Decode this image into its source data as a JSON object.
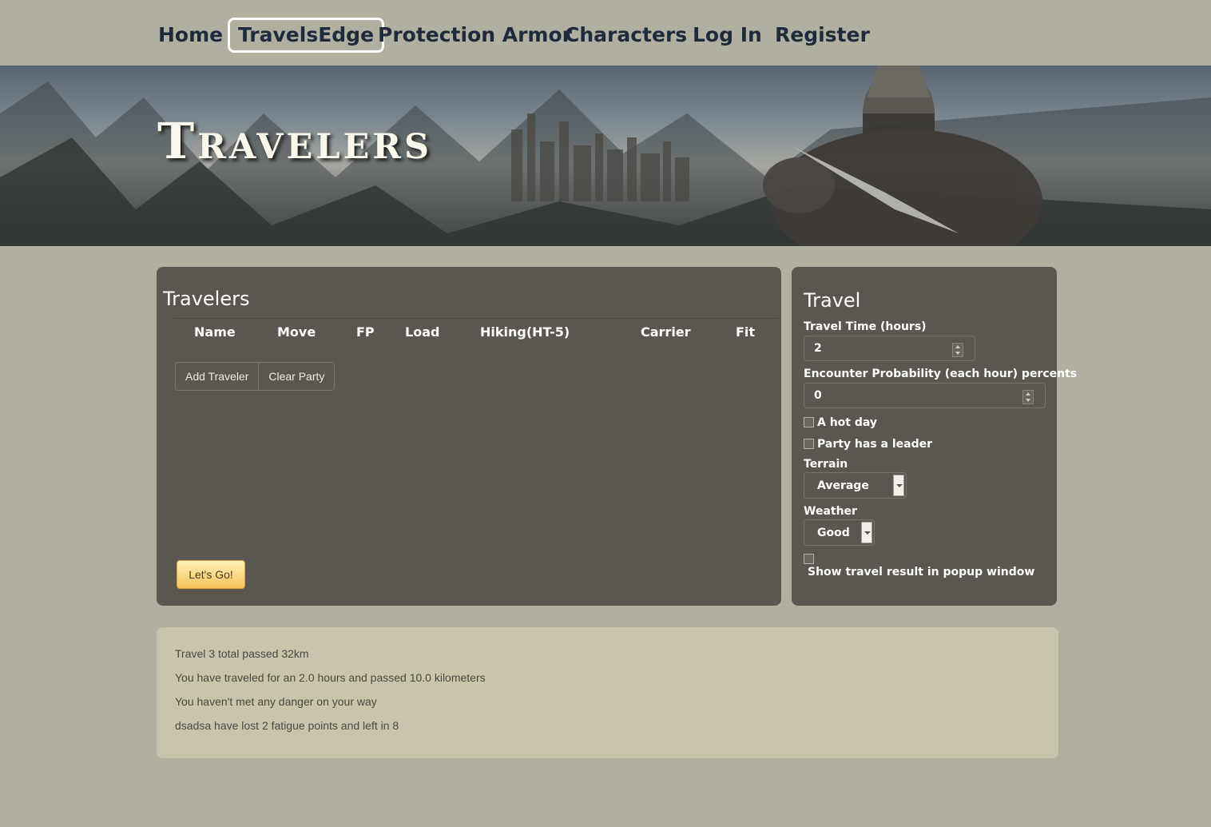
{
  "nav": {
    "items": [
      "Home",
      "TravelsEdge",
      "Protection Armor",
      "Characters",
      "Log In",
      "Register"
    ],
    "active": "TravelsEdge"
  },
  "banner": {
    "title": "Travelers"
  },
  "travelers": {
    "title": "Travelers",
    "columns": [
      "Name",
      "Move",
      "FP",
      "Load",
      "Hiking(HT-5)",
      "Carrier",
      "Fit"
    ],
    "add_button": "Add Traveler",
    "clear_button": "Clear Party",
    "go_button": "Let's Go!"
  },
  "travel": {
    "title": "Travel",
    "time_label": "Travel Time (hours)",
    "time_value": "2",
    "encounter_label": "Encounter Probability (each hour) percents",
    "encounter_value": "0",
    "hot_day_label": "A hot day",
    "hot_day_checked": false,
    "leader_label": "Party has a leader",
    "leader_checked": false,
    "terrain_label": "Terrain",
    "terrain_value": "Average",
    "weather_label": "Weather",
    "weather_value": "Good",
    "popup_label": "Show travel result in popup window",
    "popup_checked": false
  },
  "results": {
    "lines": [
      "Travel 3 total passed 32km",
      "You have traveled for an 2.0 hours and passed 10.0 kilometers",
      "You haven't met any danger on your way",
      "dsadsa have lost 2 fatigue points and left in 8"
    ]
  },
  "colors": {
    "page_bg": "#b1afa0",
    "panel_bg": "#5b5650",
    "results_bg": "#c9c5ad",
    "nav_text": "#1e2b3d",
    "go_button": "#f6c35a"
  }
}
